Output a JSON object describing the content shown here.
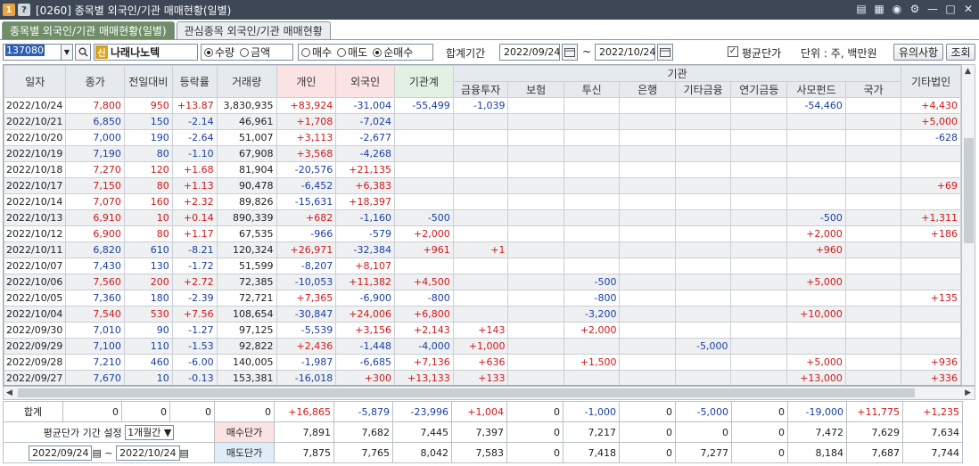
{
  "window": {
    "title": "[0260] 종목별 외국인/기관 매매현황(일별)",
    "icon1": "1",
    "icon2": "?"
  },
  "tabs": [
    {
      "label": "종목별 외국인/기관 매매현황(일별)",
      "active": true
    },
    {
      "label": "관심종목 외국인/기관 매매현황",
      "active": false
    }
  ],
  "toolbar": {
    "code": "137080",
    "new_badge": "신",
    "stock_name": "나래나노텍",
    "unit_radios": [
      {
        "label": "수량",
        "on": true
      },
      {
        "label": "금액",
        "on": false
      }
    ],
    "side_radios": [
      {
        "label": "매수",
        "on": false
      },
      {
        "label": "매도",
        "on": false
      },
      {
        "label": "순매수",
        "on": true
      }
    ],
    "period_label": "합계기간",
    "from_date": "2022/09/24",
    "tilde": "~",
    "to_date": "2022/10/24",
    "avg_price_label": "평균단가",
    "avg_price_checked": true,
    "unit_text": "단위 : 주, 백만원",
    "notice_button": "유의사항",
    "query_button": "조회"
  },
  "grid": {
    "headers": [
      "일자",
      "종가",
      "전일대비",
      "등락률",
      "거래량",
      "개인",
      "외국인",
      "기관계"
    ],
    "inst_group": "기관",
    "inst_headers": [
      "금융투자",
      "보험",
      "투신",
      "은행",
      "기타금융",
      "연기금등",
      "사모펀드",
      "국가"
    ],
    "other_corp": "기타법인",
    "rows": [
      [
        "2022/10/24",
        "7,800",
        "950",
        "+13.87",
        "3,830,935",
        "+83,924",
        "-31,004",
        "-55,499",
        "-1,039",
        "",
        "",
        "",
        "",
        "",
        "-54,460",
        "",
        "+4,430"
      ],
      [
        "2022/10/21",
        "6,850",
        "150",
        "-2.14",
        "46,961",
        "+1,708",
        "-7,024",
        "",
        "",
        "",
        "",
        "",
        "",
        "",
        "",
        "",
        "+5,000"
      ],
      [
        "2022/10/20",
        "7,000",
        "190",
        "-2.64",
        "51,007",
        "+3,113",
        "-2,677",
        "",
        "",
        "",
        "",
        "",
        "",
        "",
        "",
        "",
        "-628"
      ],
      [
        "2022/10/19",
        "7,190",
        "80",
        "-1.10",
        "67,908",
        "+3,568",
        "-4,268",
        "",
        "",
        "",
        "",
        "",
        "",
        "",
        "",
        "",
        ""
      ],
      [
        "2022/10/18",
        "7,270",
        "120",
        "+1.68",
        "81,904",
        "-20,576",
        "+21,135",
        "",
        "",
        "",
        "",
        "",
        "",
        "",
        "",
        "",
        ""
      ],
      [
        "2022/10/17",
        "7,150",
        "80",
        "+1.13",
        "90,478",
        "-6,452",
        "+6,383",
        "",
        "",
        "",
        "",
        "",
        "",
        "",
        "",
        "",
        "+69"
      ],
      [
        "2022/10/14",
        "7,070",
        "160",
        "+2.32",
        "89,826",
        "-15,631",
        "+18,397",
        "",
        "",
        "",
        "",
        "",
        "",
        "",
        "",
        "",
        ""
      ],
      [
        "2022/10/13",
        "6,910",
        "10",
        "+0.14",
        "890,339",
        "+682",
        "-1,160",
        "-500",
        "",
        "",
        "",
        "",
        "",
        "",
        "-500",
        "",
        "+1,311"
      ],
      [
        "2022/10/12",
        "6,900",
        "80",
        "+1.17",
        "67,535",
        "-966",
        "-579",
        "+2,000",
        "",
        "",
        "",
        "",
        "",
        "",
        "+2,000",
        "",
        "+186"
      ],
      [
        "2022/10/11",
        "6,820",
        "610",
        "-8.21",
        "120,324",
        "+26,971",
        "-32,384",
        "+961",
        "+1",
        "",
        "",
        "",
        "",
        "",
        "+960",
        "",
        ""
      ],
      [
        "2022/10/07",
        "7,430",
        "130",
        "-1.72",
        "51,599",
        "-8,207",
        "+8,107",
        "",
        "",
        "",
        "",
        "",
        "",
        "",
        "",
        "",
        ""
      ],
      [
        "2022/10/06",
        "7,560",
        "200",
        "+2.72",
        "72,385",
        "-10,053",
        "+11,382",
        "+4,500",
        "",
        "",
        "-500",
        "",
        "",
        "",
        "+5,000",
        "",
        ""
      ],
      [
        "2022/10/05",
        "7,360",
        "180",
        "-2.39",
        "72,721",
        "+7,365",
        "-6,900",
        "-800",
        "",
        "",
        "-800",
        "",
        "",
        "",
        "",
        "",
        "+135"
      ],
      [
        "2022/10/04",
        "7,540",
        "530",
        "+7.56",
        "108,654",
        "-30,847",
        "+24,006",
        "+6,800",
        "",
        "",
        "-3,200",
        "",
        "",
        "",
        "+10,000",
        "",
        ""
      ],
      [
        "2022/09/30",
        "7,010",
        "90",
        "-1.27",
        "97,125",
        "-5,539",
        "+3,156",
        "+2,143",
        "+143",
        "",
        "+2,000",
        "",
        "",
        "",
        "",
        "",
        ""
      ],
      [
        "2022/09/29",
        "7,100",
        "110",
        "-1.53",
        "92,822",
        "+2,436",
        "-1,448",
        "-4,000",
        "+1,000",
        "",
        "",
        "",
        "-5,000",
        "",
        "",
        "",
        ""
      ],
      [
        "2022/09/28",
        "7,210",
        "460",
        "-6.00",
        "140,005",
        "-1,987",
        "-6,685",
        "+7,136",
        "+636",
        "",
        "+1,500",
        "",
        "",
        "",
        "+5,000",
        "",
        "+936"
      ],
      [
        "2022/09/27",
        "7,670",
        "10",
        "-0.13",
        "153,381",
        "-16,018",
        "+300",
        "+13,133",
        "+133",
        "",
        "",
        "",
        "",
        "",
        "+13,000",
        "",
        "+336"
      ]
    ],
    "price_dirs": [
      "up",
      "dn",
      "dn",
      "dn",
      "up",
      "up",
      "up",
      "up",
      "up",
      "dn",
      "dn",
      "up",
      "dn",
      "up",
      "dn",
      "dn",
      "dn",
      "dn"
    ]
  },
  "summary": {
    "total_label": "합계",
    "total_row": [
      "0",
      "0",
      "0",
      "0",
      "+16,865",
      "-5,879",
      "-23,996",
      "+1,004",
      "0",
      "-1,000",
      "0",
      "-5,000",
      "0",
      "-19,000",
      "+11,775",
      "+1,235"
    ],
    "avg_period_label": "평균단가 기간 설정",
    "avg_period_value": "1개월간",
    "buy_label": "매수단가",
    "buy_row": [
      "7,891",
      "7,682",
      "7,445",
      "7,397",
      "0",
      "7,217",
      "0",
      "0",
      "0",
      "7,472",
      "7,629",
      "7,634"
    ],
    "from_date": "2022/09/24",
    "tilde": "~",
    "to_date": "2022/10/24",
    "sell_label": "매도단가",
    "sell_row": [
      "7,875",
      "7,765",
      "8,042",
      "7,583",
      "0",
      "7,418",
      "0",
      "7,277",
      "0",
      "8,184",
      "7,687",
      "7,744"
    ]
  },
  "colors": {
    "up": "#d01818",
    "down": "#1a3fa3",
    "title_bg": "#3d4756",
    "active_tab": "#6f8e67"
  }
}
